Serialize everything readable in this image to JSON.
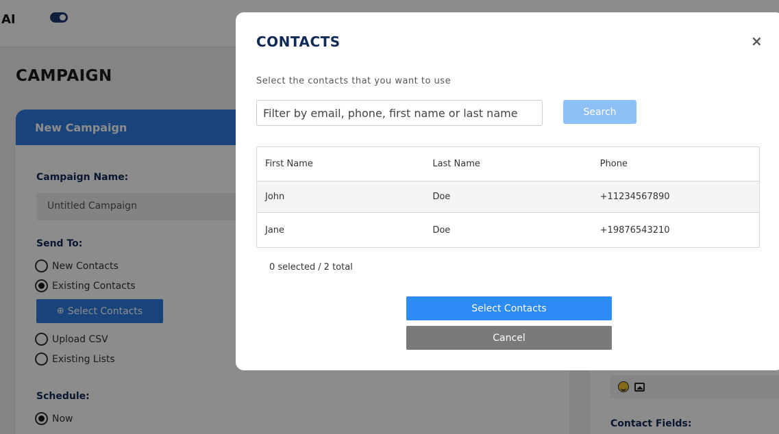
{
  "header": {
    "brand": "AI"
  },
  "page": {
    "title": "CAMPAIGN"
  },
  "campaign_form": {
    "card_title": "New Campaign",
    "name_label": "Campaign Name:",
    "name_value": "Untitled Campaign",
    "send_to_label": "Send To:",
    "send_to_options": [
      {
        "label": "New Contacts",
        "checked": false
      },
      {
        "label": "Existing Contacts",
        "checked": true
      },
      {
        "label": "Upload CSV",
        "checked": false
      },
      {
        "label": "Existing Lists",
        "checked": false
      }
    ],
    "select_contacts_label": "Select Contacts",
    "schedule_label": "Schedule:",
    "schedule_options": [
      {
        "label": "Now",
        "checked": true
      }
    ]
  },
  "side_panel": {
    "contact_fields_label": "Contact Fields:"
  },
  "modal": {
    "title": "CONTACTS",
    "close_glyph": "×",
    "subtitle": "Select the contacts that you want to use",
    "filter_placeholder": "Filter by email, phone, first name or last name",
    "search_label": "Search",
    "columns": [
      "First Name",
      "Last Name",
      "Phone"
    ],
    "rows": [
      [
        "John",
        "Doe",
        "+11234567890"
      ],
      [
        "Jane",
        "Doe",
        "+19876543210"
      ]
    ],
    "selected_text": "0 selected",
    "separator": "/",
    "total_text": "2 total",
    "select_button": "Select Contacts",
    "cancel_button": "Cancel"
  },
  "colors": {
    "primary": "#2f7de1",
    "primary_button": "#2d8bf5",
    "search_button": "#8ec0f8",
    "cancel_button": "#7a7a7a",
    "heading": "#0f2a57"
  },
  "icons": [
    "toggle-switch-icon",
    "magnifier-plus-icon",
    "close-icon",
    "emoji-icon",
    "image-icon"
  ]
}
